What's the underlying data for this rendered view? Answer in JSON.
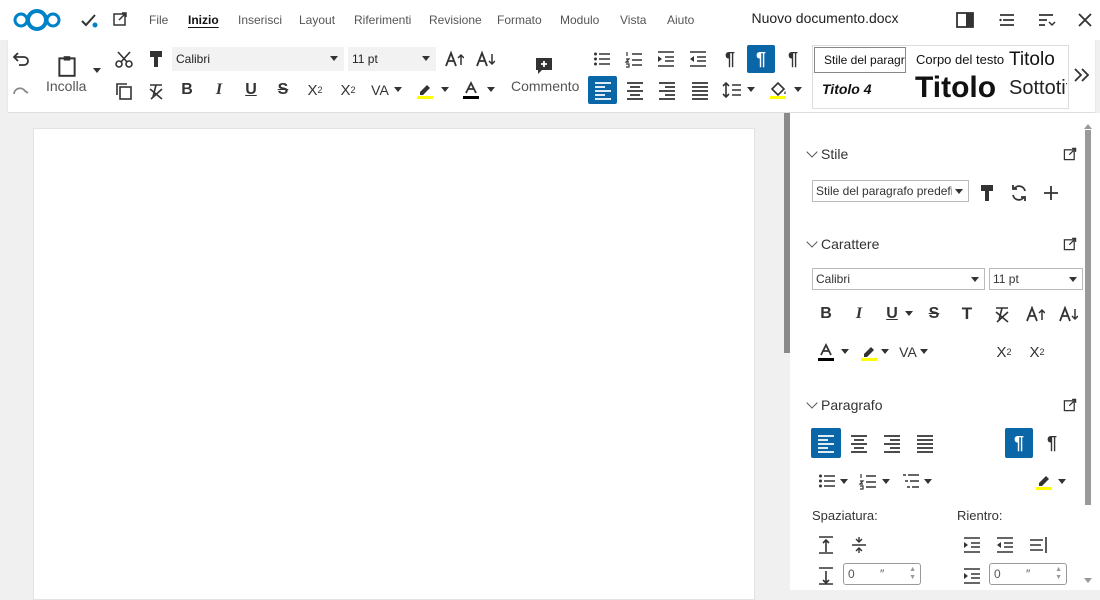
{
  "header": {
    "menus": [
      "File",
      "Inizio",
      "Inserisci",
      "Layout",
      "Riferimenti",
      "Revisione",
      "Formato",
      "Modulo",
      "Vista",
      "Aiuto"
    ],
    "active_menu": "Inizio",
    "document_title": "Nuovo documento.docx"
  },
  "ribbon": {
    "paste_label": "Incolla",
    "font_name": "Calibri",
    "font_size": "11 pt",
    "comment_label": "Commento",
    "styles": {
      "para_default": "Stile del paragrafo predefinito",
      "body_text": "Corpo del testo",
      "title_small": "Titolo",
      "heading4": "Titolo 4",
      "title_big": "Titolo",
      "subtitle": "Sottotitolo"
    },
    "font_color": "#000000",
    "highlight_color": "#ffff00"
  },
  "sidebar": {
    "style_section": "Stile",
    "style_value": "Stile del paragrafo predefinito",
    "char_section": "Carattere",
    "char_font": "Calibri",
    "char_size": "11 pt",
    "para_section": "Paragrafo",
    "spacing_label": "Spaziatura:",
    "indent_label": "Rientro:",
    "spacing_value": "0",
    "spacing_unit": "″",
    "indent_value": "0",
    "indent_unit": "″"
  },
  "colors": {
    "accent": "#0b66a8",
    "nextcloud_blue": "#0082c9"
  }
}
